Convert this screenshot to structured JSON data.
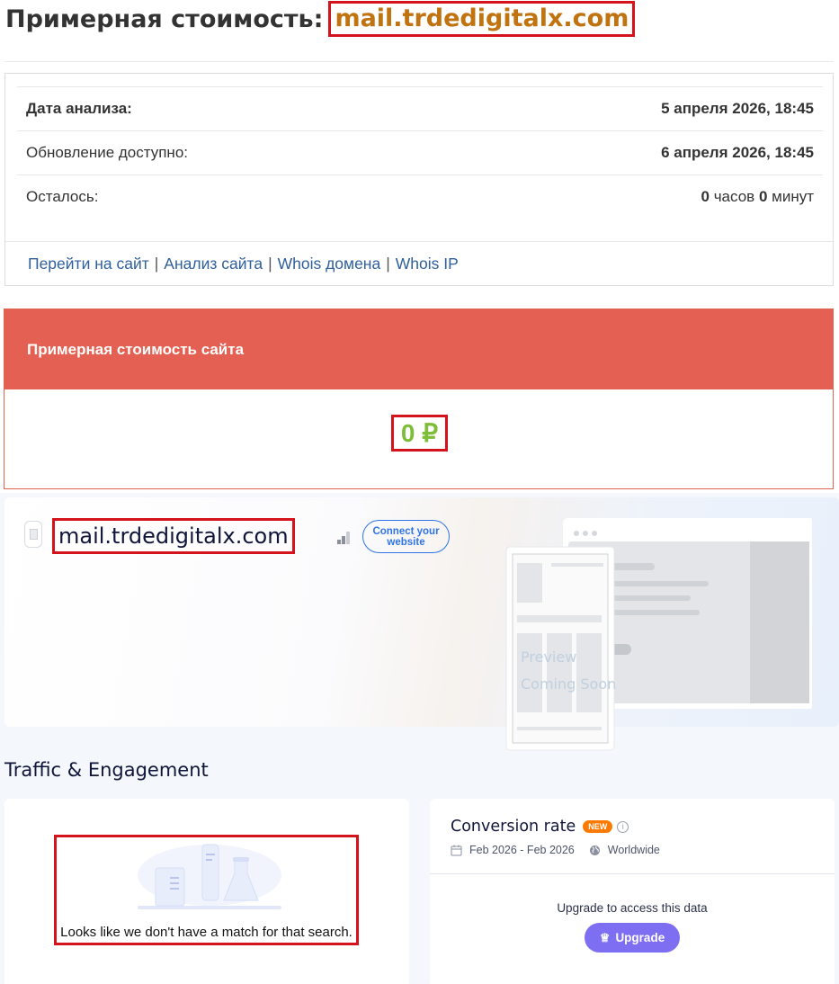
{
  "header": {
    "title_prefix": "Примерная стоимость:",
    "domain": "mail.trdedigitalx.com"
  },
  "info": {
    "rows": [
      {
        "label": "Дата анализа:",
        "value": "5 апреля 2026, 18:45"
      },
      {
        "label": "Обновление доступно:",
        "value": "6 апреля 2026, 18:45"
      },
      {
        "label": "Осталось:",
        "hours": "0",
        "hours_unit": "часов",
        "minutes": "0",
        "minutes_unit": "минут"
      }
    ],
    "links": [
      "Перейти на сайт",
      "Анализ сайта",
      "Whois домена",
      "Whois IP"
    ],
    "separator": "|"
  },
  "price": {
    "heading": "Примерная стоимость сайта",
    "value": "0 ₽"
  },
  "similarweb": {
    "domain": "mail.trdedigitalx.com",
    "connect_button": "Connect your website",
    "preview_text_1": "Preview",
    "preview_text_2": "Coming Soon",
    "section_title": "Traffic & Engagement",
    "no_match_text": "Looks like we don't have a match for that search.",
    "conversion": {
      "title": "Conversion rate",
      "badge": "NEW",
      "info_glyph": "i",
      "date_range": "Feb 2026 - Feb 2026",
      "region": "Worldwide",
      "upgrade_text": "Upgrade to access this data",
      "upgrade_button": "Upgrade"
    }
  },
  "colors": {
    "domain_accent": "#c0730f",
    "highlight_box": "#d4141c",
    "price_header": "#e46052",
    "price_value": "#7dbd3a",
    "link": "#2f5f9b",
    "upgrade": "#7d6ef2",
    "new_badge": "#ff7a00"
  }
}
